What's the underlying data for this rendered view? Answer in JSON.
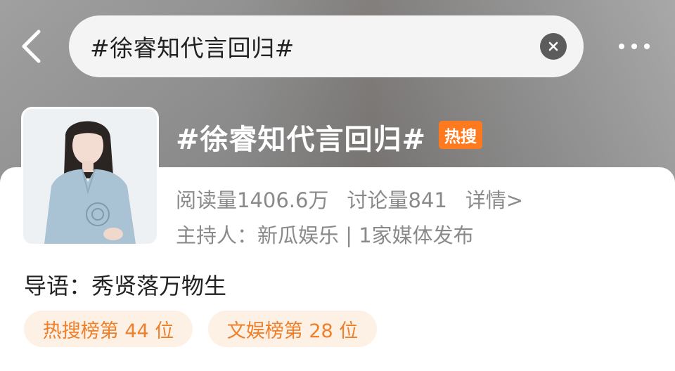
{
  "search": {
    "query": "#徐睿知代言回归#"
  },
  "topic": {
    "title": "#徐睿知代言回归#",
    "hot_badge": "热搜",
    "reads": "阅读量1406.6万",
    "discussions": "讨论量841",
    "details_link": "详情>",
    "host_line": "主持人：新瓜娱乐 | 1家媒体发布",
    "guide": "导语：秀贤落万物生"
  },
  "ranks": [
    {
      "label": "热搜榜第 44 位"
    },
    {
      "label": "文娱榜第 28 位"
    }
  ],
  "colors": {
    "hot_badge": "#ff7a1f",
    "rank_text": "#ef7f28",
    "rank_bg": "#fdf1e6"
  },
  "icons": {
    "back": "chevron-left-icon",
    "clear": "close-circle-icon",
    "more": "more-horizontal-icon"
  }
}
